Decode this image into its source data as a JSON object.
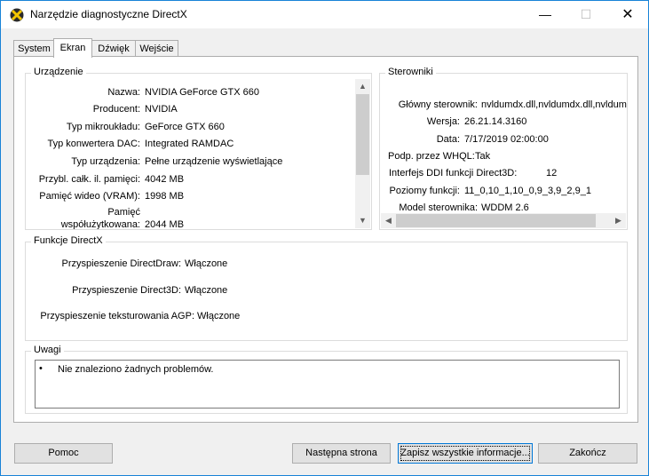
{
  "window": {
    "title": "Narzędzie diagnostyczne DirectX",
    "controls": {
      "minimize": "—",
      "maximize": "☐",
      "close": "✕"
    }
  },
  "tabs": [
    {
      "label": "System"
    },
    {
      "label": "Ekran"
    },
    {
      "label": "Dźwięk"
    },
    {
      "label": "Wejście"
    }
  ],
  "device": {
    "title": "Urządzenie",
    "rows": [
      {
        "label": "Nazwa:",
        "value": "NVIDIA GeForce GTX 660"
      },
      {
        "label": "Producent:",
        "value": "NVIDIA"
      },
      {
        "label": "Typ mikroukładu:",
        "value": "GeForce GTX 660"
      },
      {
        "label": "Typ konwertera DAC:",
        "value": "Integrated RAMDAC"
      },
      {
        "label": "Typ urządzenia:",
        "value": "Pełne urządzenie wyświetlające"
      },
      {
        "label": "Przybl. całk. il. pamięci:",
        "value": "4042 MB"
      },
      {
        "label": "Pamięć wideo (VRAM):",
        "value": "1998 MB"
      },
      {
        "label_line1": "Pamięć",
        "label_line2": "współużytkowana:",
        "value": "2044 MB"
      }
    ]
  },
  "drivers": {
    "title": "Sterowniki",
    "rows": [
      {
        "label": "Główny sterownik:",
        "value": "nvldumdx.dll,nvldumdx.dll,nvldumdx"
      },
      {
        "label": "Wersja:",
        "value": "26.21.14.3160"
      },
      {
        "label": "Data:",
        "value": "7/17/2019 02:00:00"
      },
      {
        "label": "Podp. przez WHQL:",
        "value": "Tak"
      },
      {
        "label": "Interfejs DDI funkcji Direct3D:",
        "value": "12"
      },
      {
        "label": "Poziomy funkcji:",
        "value": "11_0,10_1,10_0,9_3,9_2,9_1"
      },
      {
        "label": "Model sterownika:",
        "value": "WDDM 2.6"
      }
    ]
  },
  "directx": {
    "title": "Funkcje DirectX",
    "rows": [
      {
        "label": "Przyspieszenie DirectDraw:",
        "value": "Włączone"
      },
      {
        "label": "Przyspieszenie Direct3D:",
        "value": "Włączone"
      },
      {
        "label": "Przyspieszenie teksturowania AGP:",
        "value": "Włączone"
      }
    ]
  },
  "notes": {
    "title": "Uwagi",
    "bullet": "•",
    "items": [
      "Nie znaleziono żadnych problemów."
    ]
  },
  "buttons": {
    "help": "Pomoc",
    "next": "Następna strona",
    "save": "Zapisz wszystkie informacje...",
    "exit": "Zakończ"
  }
}
